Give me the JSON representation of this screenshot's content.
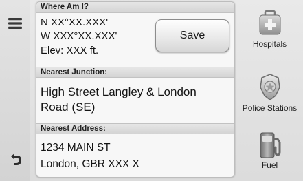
{
  "sections": {
    "where_am_i": "Where Am I?",
    "nearest_junction": "Nearest Junction:",
    "nearest_address": "Nearest Address:"
  },
  "location": {
    "latitude": "N XX°XX.XXX'",
    "longitude": "W XXX°XX.XXX'",
    "elevation": "Elev: XXX ft."
  },
  "save_label": "Save",
  "junction": "High Street Langley & London Road (SE)",
  "address": {
    "line1": "1234 MAIN ST",
    "line2": "London, GBR XXX X"
  },
  "categories": [
    {
      "label": "Hospitals",
      "icon": "hospital-icon"
    },
    {
      "label": "Police Stations",
      "icon": "police-badge-icon"
    },
    {
      "label": "Fuel",
      "icon": "fuel-pump-icon"
    }
  ],
  "nav": {
    "menu_icon": "menu-icon",
    "back_icon": "back-arrow-icon"
  }
}
